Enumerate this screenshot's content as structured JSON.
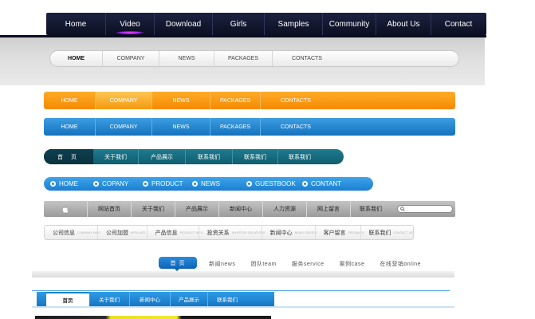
{
  "nav1": {
    "items": [
      "Home",
      "Video",
      "Download",
      "Girls",
      "Samples",
      "Community",
      "About Us",
      "Contact"
    ],
    "active_index": 1
  },
  "nav2": {
    "items": [
      "HOME",
      "COMPANY",
      "NEWS",
      "PACKAGES",
      "CONTACTS"
    ],
    "active_index": 0
  },
  "nav3": {
    "items": [
      "HOME",
      "COMPANY",
      "NEWS",
      "PACKAGES",
      "CONTACTS"
    ],
    "active_index": 1,
    "color": "#f58a00"
  },
  "nav4": {
    "items": [
      "HOME",
      "COMPANY",
      "NEWS",
      "PACKAGES",
      "CONTACTS"
    ],
    "color": "#1372bd"
  },
  "nav5": {
    "items": [
      "首 页",
      "关于我们",
      "产品展示",
      "联系我们",
      "联系我们",
      "联系我们"
    ],
    "color": "#0f5e70"
  },
  "nav6": {
    "items": [
      "HOME",
      "COPANY",
      "PRODUCT",
      "NEWS",
      "GUESTBOOK",
      "CONTANT"
    ],
    "color": "#1a7fd0"
  },
  "nav7": {
    "home_icon": "apple-icon",
    "items": [
      "网站首页",
      "关于我们",
      "产品展示",
      "新闻中心",
      "人力资源",
      "网上留言",
      "联系我们"
    ]
  },
  "nav8": {
    "items": [
      {
        "label": "公司信息",
        "sub": "COMPANY INFO"
      },
      {
        "label": "公司加盟",
        "sub": "AFFILIATE"
      },
      {
        "label": "产品信息",
        "sub": "PRODUCT INFO"
      },
      {
        "label": "投资关系",
        "sub": "INVESTOR RELATIONS"
      },
      {
        "label": "新闻中心",
        "sub": "NEWS CENTER"
      },
      {
        "label": "客户留言",
        "sub": "FEEDBACK"
      },
      {
        "label": "联系我们",
        "sub": "CONTACT US"
      }
    ]
  },
  "nav9": {
    "active": "首 页",
    "items": [
      "新闻news",
      "团队team",
      "服务service",
      "案例case",
      "在线营销online"
    ]
  },
  "nav10": {
    "items": [
      "首页",
      "关于我们",
      "新闻中心",
      "产品展示",
      "联系我们"
    ],
    "active_index": 0
  }
}
